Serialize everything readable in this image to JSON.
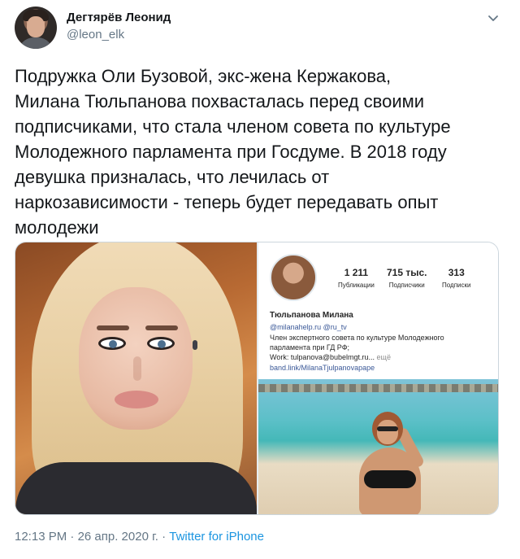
{
  "author": {
    "name": "Дегтярёв Леонид",
    "handle": "@leon_elk"
  },
  "tweet": {
    "text": "Подружка Оли Бузовой, экс-жена Кержакова,\nМилана Тюльпанова похвасталась перед своими\nподписчиками, что стала членом совета по культуре\nМолодежного парламента при Госдуме. В 2018 году\nдевушка призналась, что лечилась от\nнаркозависимости - теперь будет передавать опыт\nмолодежи"
  },
  "media": {
    "profile": {
      "stats": [
        {
          "num": "1 211",
          "label": "Публикации"
        },
        {
          "num": "715 тыс.",
          "label": "Подписчики"
        },
        {
          "num": "313",
          "label": "Подписки"
        }
      ],
      "name": "Тюльпанова Милана",
      "mentions": "@milanahelp.ru @ru_tv",
      "bio_line1": "Член экспертного совета по культуре Молодежного",
      "bio_line2": "парламента при ГД РФ;",
      "work": "Work: tulpanova@bubelmgt.ru...",
      "more": " ещё",
      "link": "band.link/MilanaTjulpanovapape"
    }
  },
  "meta": {
    "time": "12:13 PM",
    "separator1": " · ",
    "date": "26 апр. 2020 г.",
    "separator2": " · ",
    "source": "Twitter for iPhone"
  },
  "icons": {
    "menu": "chevron-down-icon"
  },
  "colors": {
    "link": "#1b95e0",
    "secondary": "#657786",
    "text": "#14171a"
  }
}
